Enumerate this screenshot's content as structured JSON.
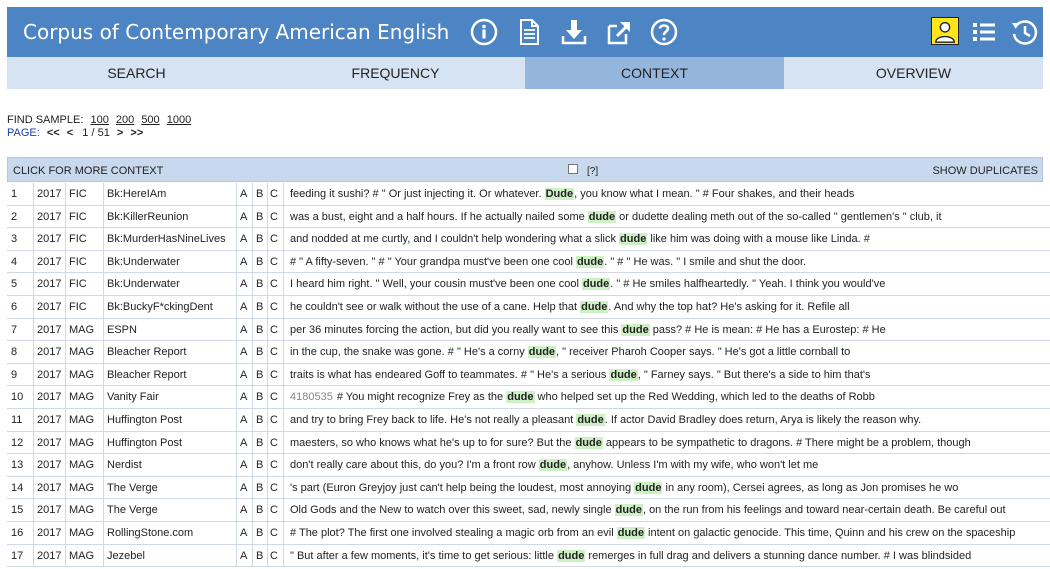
{
  "header": {
    "title": "Corpus of Contemporary American English",
    "icons": [
      "info-icon",
      "document-icon",
      "download-icon",
      "export-icon",
      "help-icon"
    ],
    "right_icons": [
      "user-icon",
      "list-icon",
      "history-icon"
    ]
  },
  "tabs": [
    {
      "label": "SEARCH",
      "active": false
    },
    {
      "label": "FREQUENCY",
      "active": false
    },
    {
      "label": "CONTEXT",
      "active": true
    },
    {
      "label": "OVERVIEW",
      "active": false
    }
  ],
  "find_sample": {
    "label": "FIND SAMPLE:",
    "options": [
      "100",
      "200",
      "500",
      "1000"
    ]
  },
  "page": {
    "label": "PAGE:",
    "first": "<<",
    "prev": "<",
    "current": "1 / 51",
    "next": ">",
    "last": ">>"
  },
  "context_bar": {
    "label": "CLICK FOR MORE CONTEXT",
    "help": "[?]",
    "show_duplicates": "SHOW DUPLICATES"
  },
  "rows": [
    {
      "num": "1",
      "year": "2017",
      "genre": "FIC",
      "source": "Bk:HereIAm",
      "a": "A",
      "b": "B",
      "c": "C",
      "pre": "feeding it sushi? # \" Or just injecting it. Or whatever. ",
      "kw": "Dude",
      "post": ", you know what I mean. \" # Four shakes, and their heads"
    },
    {
      "num": "2",
      "year": "2017",
      "genre": "FIC",
      "source": "Bk:KillerReunion",
      "a": "A",
      "b": "B",
      "c": "C",
      "pre": "was a bust, eight and a half hours. If he actually nailed some ",
      "kw": "dude",
      "post": " or dudette dealing meth out of the so-called \" gentlemen's \" club, it"
    },
    {
      "num": "3",
      "year": "2017",
      "genre": "FIC",
      "source": "Bk:MurderHasNineLives",
      "a": "A",
      "b": "B",
      "c": "C",
      "pre": "and nodded at me curtly, and I couldn't help wondering what a slick ",
      "kw": "dude",
      "post": " like him was doing with a mouse like Linda. #"
    },
    {
      "num": "4",
      "year": "2017",
      "genre": "FIC",
      "source": "Bk:Underwater",
      "a": "A",
      "b": "B",
      "c": "C",
      "pre": "# \" A fifty-seven. \" # \" Your grandpa must've been one cool ",
      "kw": "dude",
      "post": ". \" # \" He was. \" I smile and shut the door."
    },
    {
      "num": "5",
      "year": "2017",
      "genre": "FIC",
      "source": "Bk:Underwater",
      "a": "A",
      "b": "B",
      "c": "C",
      "pre": "I heard him right. \" Well, your cousin must've been one cool ",
      "kw": "dude",
      "post": ". \" # He smiles halfheartedly. \" Yeah. I think you would've"
    },
    {
      "num": "6",
      "year": "2017",
      "genre": "FIC",
      "source": "Bk:BuckyF*ckingDent",
      "a": "A",
      "b": "B",
      "c": "C",
      "pre": "he couldn't see or walk without the use of a cane. Help that ",
      "kw": "dude",
      "post": ". And why the top hat? He's asking for it. Refile all"
    },
    {
      "num": "7",
      "year": "2017",
      "genre": "MAG",
      "source": "ESPN",
      "a": "A",
      "b": "B",
      "c": "C",
      "pre": "per 36 minutes forcing the action, but did you really want to see this ",
      "kw": "dude",
      "post": " pass? # He is mean: # He has a Eurostep: # He"
    },
    {
      "num": "8",
      "year": "2017",
      "genre": "MAG",
      "source": "Bleacher Report",
      "a": "A",
      "b": "B",
      "c": "C",
      "pre": "in the cup, the snake was gone. # \" He's a corny ",
      "kw": "dude",
      "post": ", \" receiver Pharoh Cooper says. \" He's got a little cornball to"
    },
    {
      "num": "9",
      "year": "2017",
      "genre": "MAG",
      "source": "Bleacher Report",
      "a": "A",
      "b": "B",
      "c": "C",
      "pre": "traits is what has endeared Goff to teammates. # \" He's a serious ",
      "kw": "dude",
      "post": ", \" Farney says. \" But there's a side to him that's"
    },
    {
      "num": "10",
      "year": "2017",
      "genre": "MAG",
      "source": "Vanity Fair",
      "a": "A",
      "b": "B",
      "c": "C",
      "id": "4180535",
      "pre": "# You might recognize Frey as the ",
      "kw": "dude",
      "post": " who helped set up the Red Wedding, which led to the deaths of Robb"
    },
    {
      "num": "11",
      "year": "2017",
      "genre": "MAG",
      "source": "Huffington Post",
      "a": "A",
      "b": "B",
      "c": "C",
      "pre": "and try to bring Frey back to life. He's not really a pleasant ",
      "kw": "dude",
      "post": ". If actor David Bradley does return, Arya is likely the reason why."
    },
    {
      "num": "12",
      "year": "2017",
      "genre": "MAG",
      "source": "Huffington Post",
      "a": "A",
      "b": "B",
      "c": "C",
      "pre": "maesters, so who knows what he's up to for sure? But the ",
      "kw": "dude",
      "post": " appears to be sympathetic to dragons. # There might be a problem, though"
    },
    {
      "num": "13",
      "year": "2017",
      "genre": "MAG",
      "source": "Nerdist",
      "a": "A",
      "b": "B",
      "c": "C",
      "pre": "don't really care about this, do you? I'm a front row ",
      "kw": "dude",
      "post": ", anyhow. Unless I'm with my wife, who won't let me"
    },
    {
      "num": "14",
      "year": "2017",
      "genre": "MAG",
      "source": "The Verge",
      "a": "A",
      "b": "B",
      "c": "C",
      "pre": "'s part (Euron Greyjoy just can't help being the loudest, most annoying ",
      "kw": "dude",
      "post": " in any room), Cersei agrees, as long as Jon promises he wo"
    },
    {
      "num": "15",
      "year": "2017",
      "genre": "MAG",
      "source": "The Verge",
      "a": "A",
      "b": "B",
      "c": "C",
      "pre": "Old Gods and the New to watch over this sweet, sad, newly single ",
      "kw": "dude",
      "post": ", on the run from his feelings and toward near-certain death. Be careful out"
    },
    {
      "num": "16",
      "year": "2017",
      "genre": "MAG",
      "source": "RollingStone.com",
      "a": "A",
      "b": "B",
      "c": "C",
      "pre": "# The plot? The first one involved stealing a magic orb from an evil ",
      "kw": "dude",
      "post": " intent on galactic genocide. This time, Quinn and his crew on the spaceship"
    },
    {
      "num": "17",
      "year": "2017",
      "genre": "MAG",
      "source": "Jezebel",
      "a": "A",
      "b": "B",
      "c": "C",
      "pre": "\" But after a few moments, it's time to get serious: little ",
      "kw": "dude",
      "post": " remerges in full drag and delivers a stunning dance number. # I was blindsided"
    }
  ]
}
